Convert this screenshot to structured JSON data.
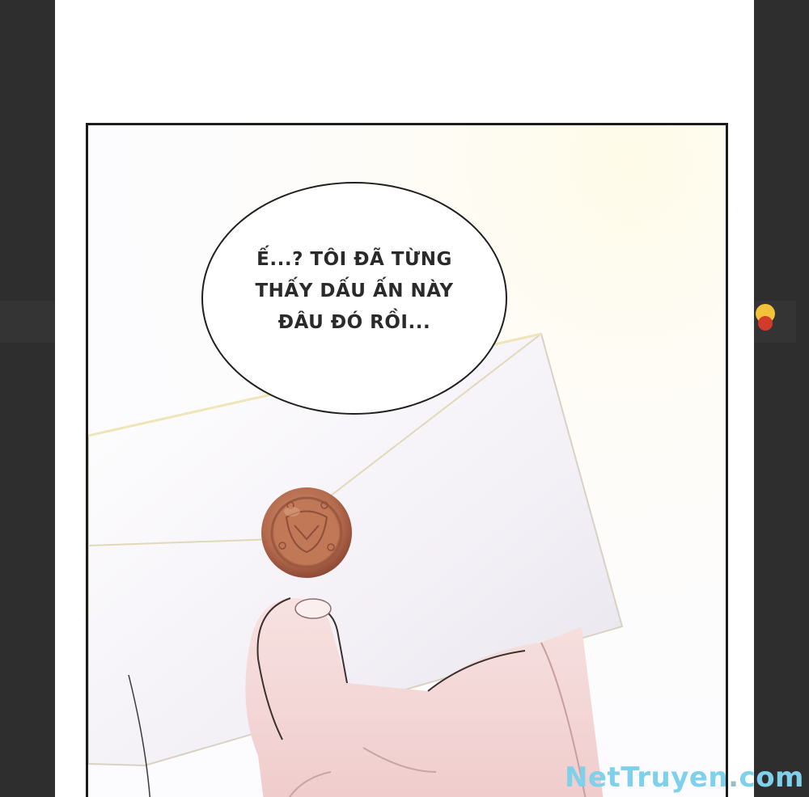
{
  "speech_bubble": {
    "lines": [
      "Ế...? TÔI ĐÃ TỪNG",
      "THẤY DẤU ẤN NÀY",
      "ĐÂU ĐÓ RỒI..."
    ]
  },
  "watermark": {
    "part1": "NetTruyen",
    "part2": ".",
    "part3": "com"
  },
  "colors": {
    "outer_background": "#2e2e2e",
    "page": "#ffffff",
    "panel_border": "#1b1b1b",
    "wax_seal": "#b86d4e",
    "skin": "#f1d4d3",
    "watermark": "#7fd0ea"
  }
}
